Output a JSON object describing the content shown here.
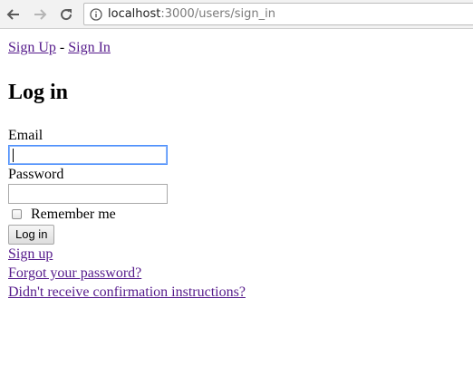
{
  "browser": {
    "url_host": "localhost",
    "url_path": ":3000/users/sign_in",
    "icons": [
      "back-arrow-icon",
      "forward-arrow-icon",
      "reload-icon",
      "info-icon"
    ]
  },
  "nav": {
    "sign_up": "Sign Up",
    "separator": " - ",
    "sign_in": "Sign In"
  },
  "form": {
    "title": "Log in",
    "email_label": "Email",
    "email_value": "",
    "password_label": "Password",
    "password_value": "",
    "remember_label": "Remember me",
    "remember_checked": false,
    "submit_label": "Log in"
  },
  "links": {
    "sign_up": "Sign up",
    "forgot": "Forgot your password?",
    "confirm": "Didn't receive confirmation instructions?"
  },
  "colors": {
    "link_visited": "#551a8b",
    "link": "#0000ee",
    "focus_ring": "#4d90fe"
  }
}
